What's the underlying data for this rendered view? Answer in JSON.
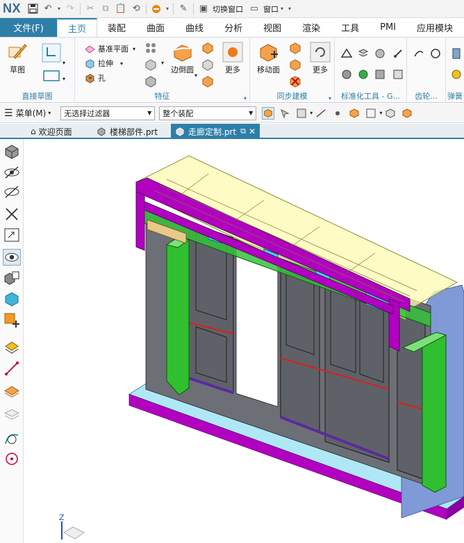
{
  "app": {
    "logo": "NX"
  },
  "quick_access": {
    "switch_window": "切换窗口",
    "window": "窗口"
  },
  "tabs": [
    {
      "label": "文件(F)"
    },
    {
      "label": "主页"
    },
    {
      "label": "装配"
    },
    {
      "label": "曲面"
    },
    {
      "label": "曲线"
    },
    {
      "label": "分析"
    },
    {
      "label": "视图"
    },
    {
      "label": "渲染"
    },
    {
      "label": "工具"
    },
    {
      "label": "PMI"
    },
    {
      "label": "应用模块"
    }
  ],
  "ribbon": {
    "sketch": {
      "label": "草图",
      "group": "直接草图"
    },
    "feature": {
      "datum_plane": "基准平面",
      "extrude": "拉伸",
      "hole": "孔",
      "edge_blend": "边倒圆",
      "more": "更多",
      "group": "特征"
    },
    "sync": {
      "move_face": "移动面",
      "more": "更多",
      "group": "同步建模"
    },
    "standard": {
      "group": "标准化工具 - G..."
    },
    "gear": {
      "group": "齿轮..."
    },
    "spring": {
      "group": "弹簧"
    }
  },
  "selbar": {
    "menu": "菜单(M)",
    "filter": "无选择过滤器",
    "scope": "整个装配"
  },
  "doc_tabs": [
    {
      "label": "欢迎页面"
    },
    {
      "label": "楼梯部件.prt"
    },
    {
      "label": "走廊定制.prt"
    }
  ],
  "viewport": {
    "axis_label": "Z"
  },
  "colors": {
    "accent": "#2e7fa8",
    "magenta": "#b100c0",
    "green": "#2fbf2f",
    "cyan": "#3fd8e8",
    "wall": "#6d6f76",
    "floor": "#aee8f6",
    "side": "#7f9ad6"
  }
}
